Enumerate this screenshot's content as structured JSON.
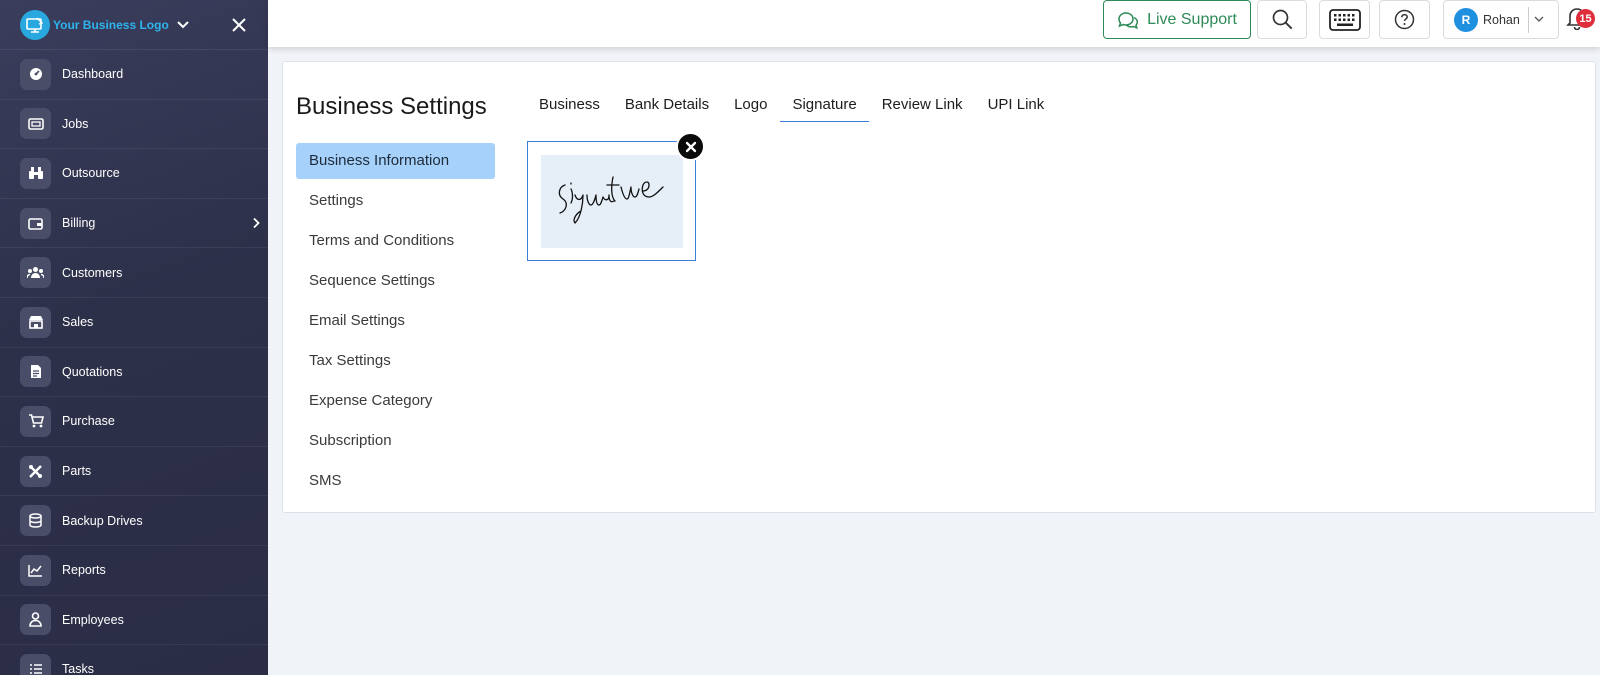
{
  "sidebar": {
    "brand": "Your Business Logo",
    "items": [
      {
        "label": "Dashboard",
        "icon": "speedometer-icon"
      },
      {
        "label": "Jobs",
        "icon": "ticket-icon"
      },
      {
        "label": "Outsource",
        "icon": "binoculars-icon"
      },
      {
        "label": "Billing",
        "icon": "wallet-icon",
        "has_submenu": true
      },
      {
        "label": "Customers",
        "icon": "people-icon"
      },
      {
        "label": "Sales",
        "icon": "store-icon"
      },
      {
        "label": "Quotations",
        "icon": "document-icon"
      },
      {
        "label": "Purchase",
        "icon": "cart-icon"
      },
      {
        "label": "Parts",
        "icon": "tools-icon"
      },
      {
        "label": "Backup Drives",
        "icon": "database-icon"
      },
      {
        "label": "Reports",
        "icon": "chart-line-icon"
      },
      {
        "label": "Employees",
        "icon": "person-badge-icon"
      },
      {
        "label": "Tasks",
        "icon": "list-icon"
      }
    ]
  },
  "topbar": {
    "live_support": "Live Support",
    "user": {
      "initial": "R",
      "name": "Rohan"
    },
    "notifications": "15"
  },
  "page": {
    "title": "Business Settings",
    "menu": [
      {
        "label": "Business Information",
        "active": true
      },
      {
        "label": "Settings"
      },
      {
        "label": "Terms and Conditions"
      },
      {
        "label": "Sequence Settings"
      },
      {
        "label": "Email Settings"
      },
      {
        "label": "Tax Settings"
      },
      {
        "label": "Expense Category"
      },
      {
        "label": "Subscription"
      },
      {
        "label": "SMS"
      }
    ],
    "tabs": [
      {
        "label": "Business"
      },
      {
        "label": "Bank Details"
      },
      {
        "label": "Logo"
      },
      {
        "label": "Signature",
        "active": true
      },
      {
        "label": "Review Link"
      },
      {
        "label": "UPI Link"
      }
    ]
  },
  "colors": {
    "sidebar_bg": "#2d3049",
    "accent_blue": "#3b7dd8",
    "active_menu": "#a6d1fb",
    "live_support_green": "#2e8b57",
    "badge_red": "#e02d3c"
  }
}
